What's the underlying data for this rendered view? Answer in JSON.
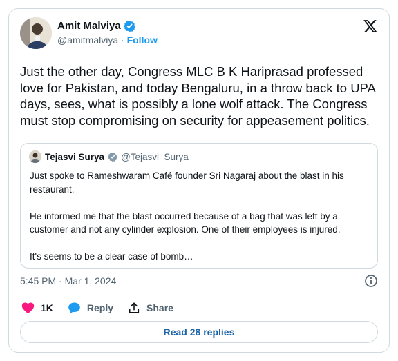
{
  "author": {
    "name": "Amit Malviya",
    "handle": "@amitmalviya",
    "separator": " · ",
    "follow_label": "Follow"
  },
  "tweet": {
    "text": "Just the other day, Congress MLC B K Hariprasad professed love for Pakistan, and today Bengaluru, in a throw back to UPA days, sees, what is possibly a lone wolf attack. The Congress must stop compromising on security for appeasement politics."
  },
  "quote": {
    "name": "Tejasvi Surya",
    "handle": "@Tejasvi_Surya",
    "paragraphs": [
      "Just spoke to Rameshwaram Café founder Sri Nagaraj about the blast in his restaurant.",
      "He informed me that the blast occurred because of a bag that was left by a customer and not any cylinder explosion. One of their employees is injured.",
      "It's seems to be a clear case of bomb…"
    ]
  },
  "timestamp": "5:45 PM · Mar 1, 2024",
  "actions": {
    "like_count": "1K",
    "reply_label": "Reply",
    "share_label": "Share"
  },
  "read_replies_label": "Read 28 replies",
  "colors": {
    "accent": "#1d9bf0",
    "like": "#f91880",
    "text": "#0f1419",
    "secondary": "#536471",
    "border": "#cfd9de"
  },
  "icons": [
    "x-logo-icon",
    "verified-badge-icon",
    "gray-verified-badge-icon",
    "info-icon",
    "heart-icon",
    "reply-bubble-icon",
    "share-icon"
  ]
}
